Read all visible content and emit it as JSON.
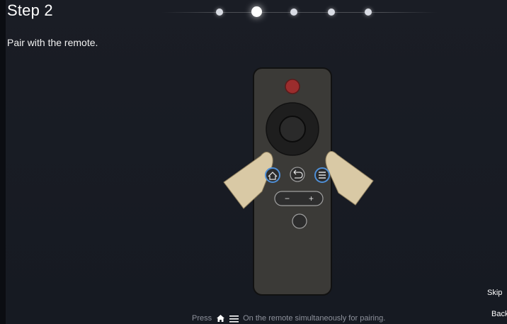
{
  "header": {
    "step_title": "Step 2",
    "instruction": "Pair with the remote.",
    "progress": {
      "total_steps": 5,
      "current_step": 2
    }
  },
  "illustration": {
    "description_icon": "remote-control-icon",
    "minus_label": "−",
    "plus_label": "+"
  },
  "footer": {
    "press_label": "Press",
    "home_icon": "home-icon",
    "menu_icon": "menu-icon",
    "hint": "On the remote simultaneously for pairing."
  },
  "actions": {
    "skip_label": "Skip",
    "back_label": "Back"
  },
  "colors": {
    "background": "#161a22",
    "remote_body": "#3b3a37",
    "power_button": "#9b2d2d",
    "hand": "#d9c9a5",
    "highlight_ring": "#4f8fd6"
  }
}
